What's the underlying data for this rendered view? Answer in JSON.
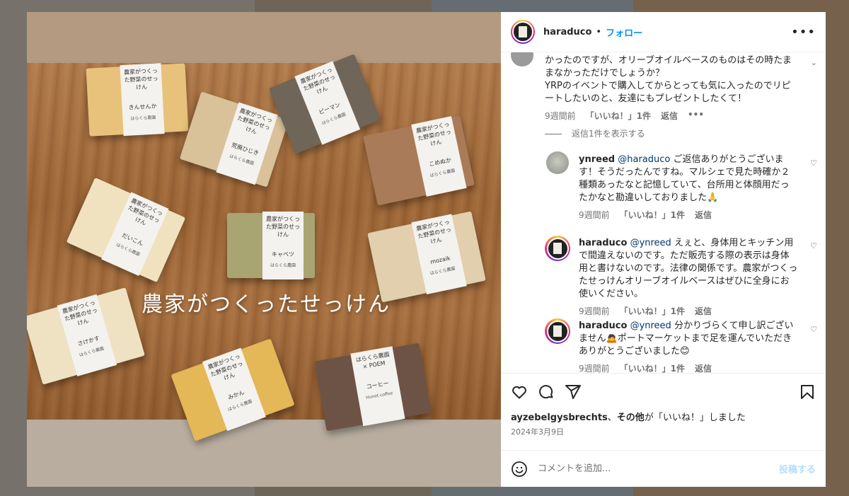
{
  "post": {
    "username": "haraduco",
    "separator": "•",
    "follow_label": "フォロー",
    "more_label": "•••",
    "image_overlay_text": "農家がつくったせっけん",
    "soaps": [
      {
        "label": "農家がつくった野菜のせっけん",
        "name": "きんせんか",
        "maker": "はらくら農園"
      },
      {
        "label": "農家がつくった野菜のせっけん",
        "name": "荒廃ひじき",
        "maker": "はらくら農園"
      },
      {
        "label": "農家がつくった野菜のせっけん",
        "name": "ピーマン",
        "maker": "はらくら農園"
      },
      {
        "label": "農家がつくった野菜のせっけん",
        "name": "こめぬか",
        "maker": "はらくら農園"
      },
      {
        "label": "農家がつくった野菜のせっけん",
        "name": "だいこん",
        "maker": "はらくら農園"
      },
      {
        "label": "農家がつくった野菜のせっけん",
        "name": "キャベツ",
        "maker": "はらくら農園"
      },
      {
        "label": "農家がつくった野菜のせっけん",
        "name": "mozaik",
        "maker": "はらくら農園"
      },
      {
        "label": "農家がつくった野菜のせっけん",
        "name": "さけかす",
        "maker": "はらくら農園"
      },
      {
        "label": "農家がつくった野菜のせっけん",
        "name": "みかん",
        "maker": "はらくら農園"
      },
      {
        "label": "はらくら農園 × POEM",
        "name": "コーヒー",
        "maker": "Hunet coffee"
      }
    ]
  },
  "comments": {
    "first": {
      "text": "かったのですが、オリーブオイルベースのものはその時たままなかっただけでしょうか？\nYRPのイベントで購入してからとっても気に入ったのでリピートしたいのと、友達にもプレゼントしたくて！",
      "time": "9週間前",
      "likes": "「いいね！」1件",
      "reply": "返信",
      "more": "•••"
    },
    "view_replies": "返信1件を表示する",
    "replies": [
      {
        "user": "ynreed",
        "mention": "@haraduco",
        "text": " ご返信ありがとうございます！そうだったんですね。マルシェで見た時確か２種類あったなと記憶していて、台所用と体顔用だったかなと勘違いしておりました🙏",
        "time": "9週間前",
        "likes": "「いいね！」1件",
        "reply": "返信"
      },
      {
        "user": "haraduco",
        "mention": "@ynreed",
        "text": " えぇと、身体用とキッチン用で間違えないのです。ただ販売する際の表示は身体用と書けないのです。法律の関係です。農家がつくったせっけんオリーブオイルベースはぜひに全身にお使いください。",
        "time": "9週間前",
        "likes": "「いいね！」1件",
        "reply": "返信"
      },
      {
        "user": "haraduco",
        "mention": "@ynreed",
        "text": " 分かりづらくて申し訳ございません🙇ポートマーケットまで足を運んでいただきありがとうございました😊",
        "time": "9週間前",
        "likes": "「いいね！」1件",
        "reply": "返信"
      }
    ]
  },
  "footer": {
    "liked_by_user": "ayzebelgysbrechts",
    "liked_by_rest": "、",
    "liked_by_others": "その他",
    "liked_by_suffix": "が「いいね！」しました",
    "date": "2024年3月9日",
    "comment_placeholder": "コメントを追加...",
    "post_label": "投稿する"
  },
  "icons": {
    "like": "heart-icon",
    "comment": "comment-icon",
    "share": "share-icon",
    "save": "bookmark-icon",
    "emoji": "emoji-icon"
  },
  "colors": {
    "follow": "#0095f6",
    "post_disabled": "#b2dffc"
  }
}
